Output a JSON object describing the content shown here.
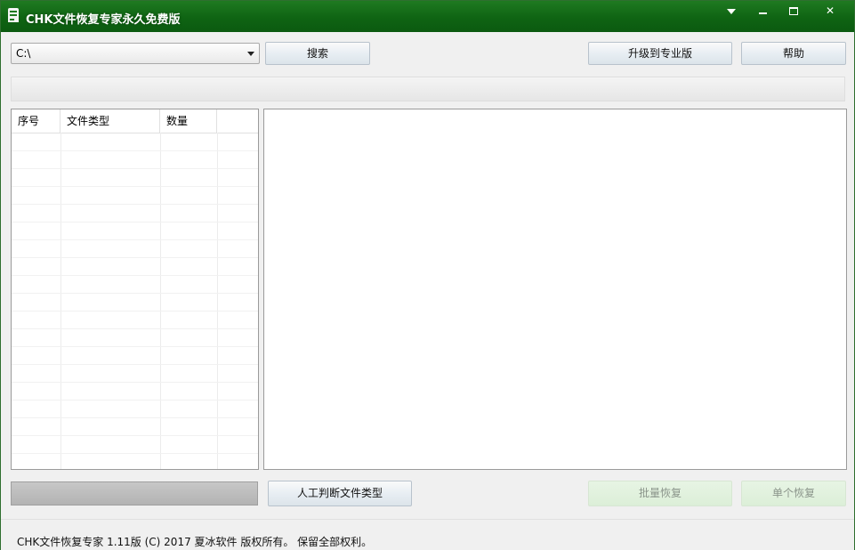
{
  "window": {
    "title": "CHK文件恢复专家永久免费版",
    "title_bar_color": "#0f6413",
    "caption_buttons": [
      "menu-icon",
      "minimize-icon",
      "maximize-icon",
      "close-icon"
    ],
    "close_glyph": "✕"
  },
  "toolbar": {
    "path_value": "C:\\",
    "search_label": "搜索",
    "upgrade_label": "升级到专业版",
    "help_label": "帮助"
  },
  "file_list": {
    "columns": [
      "序号",
      "文件类型",
      "数量"
    ],
    "rows": []
  },
  "actions": {
    "manual_type_label": "人工判断文件类型",
    "batch_recover_label": "批量恢复",
    "single_recover_label": "单个恢复"
  },
  "status": {
    "text": "CHK文件恢复专家 1.11版 (C) 2017 夏冰软件 版权所有。 保留全部权利。"
  }
}
